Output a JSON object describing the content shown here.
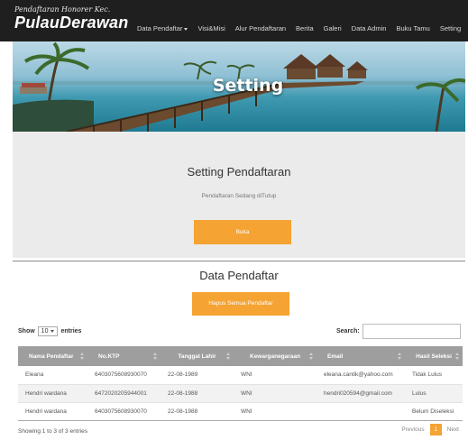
{
  "brand": {
    "subtitle": "Pendaftaran Honorer Kec.",
    "title": "PulauDerawan"
  },
  "nav": {
    "items": [
      {
        "label": "Data Pendaftar",
        "dropdown": true
      },
      {
        "label": "Visi&Misi"
      },
      {
        "label": "Alur Pendaftaran"
      },
      {
        "label": "Berita"
      },
      {
        "label": "Galeri"
      },
      {
        "label": "Data Admin"
      },
      {
        "label": "Buku Tamu"
      },
      {
        "label": "Setting"
      }
    ]
  },
  "hero": {
    "title": "Setting"
  },
  "setting": {
    "title": "Setting Pendaftaran",
    "status": "Pendaftaran Sedang diTutup",
    "open_button": "Buka"
  },
  "data_section": {
    "title": "Data Pendaftar",
    "delete_all_button": "Hapus Semua Pendaftar"
  },
  "table_controls": {
    "show_label": "Show",
    "entries_value": "10",
    "entries_label": "entries",
    "search_label": "Search:",
    "search_value": ""
  },
  "table": {
    "columns": [
      "Nama Pendaftar",
      "No.KTP",
      "Tanggal Lahir",
      "Kewarganegaraan",
      "Email",
      "Hasil Seleksi"
    ],
    "rows": [
      [
        "Eleana",
        "6403075608930070",
        "22-08-1989",
        "WNI",
        "eleana.cantik@yahoo.com",
        "Tidak Lulus"
      ],
      [
        "Hendri wardana",
        "6472020205944001",
        "22-08-1988",
        "WNI",
        "hendri020594@gmail.com",
        "Lulus"
      ],
      [
        "Hendri wardana",
        "6403075608930070",
        "22-08-1988",
        "WNI",
        "",
        "Belum Diseleksi"
      ]
    ]
  },
  "footer": {
    "info": "Showing 1 to 3 of 3 entries",
    "previous": "Previous",
    "current_page": "1",
    "next": "Next"
  },
  "colors": {
    "accent": "#f5a332",
    "navbar": "#1f1f1f",
    "table_header": "#9e9e9e"
  }
}
